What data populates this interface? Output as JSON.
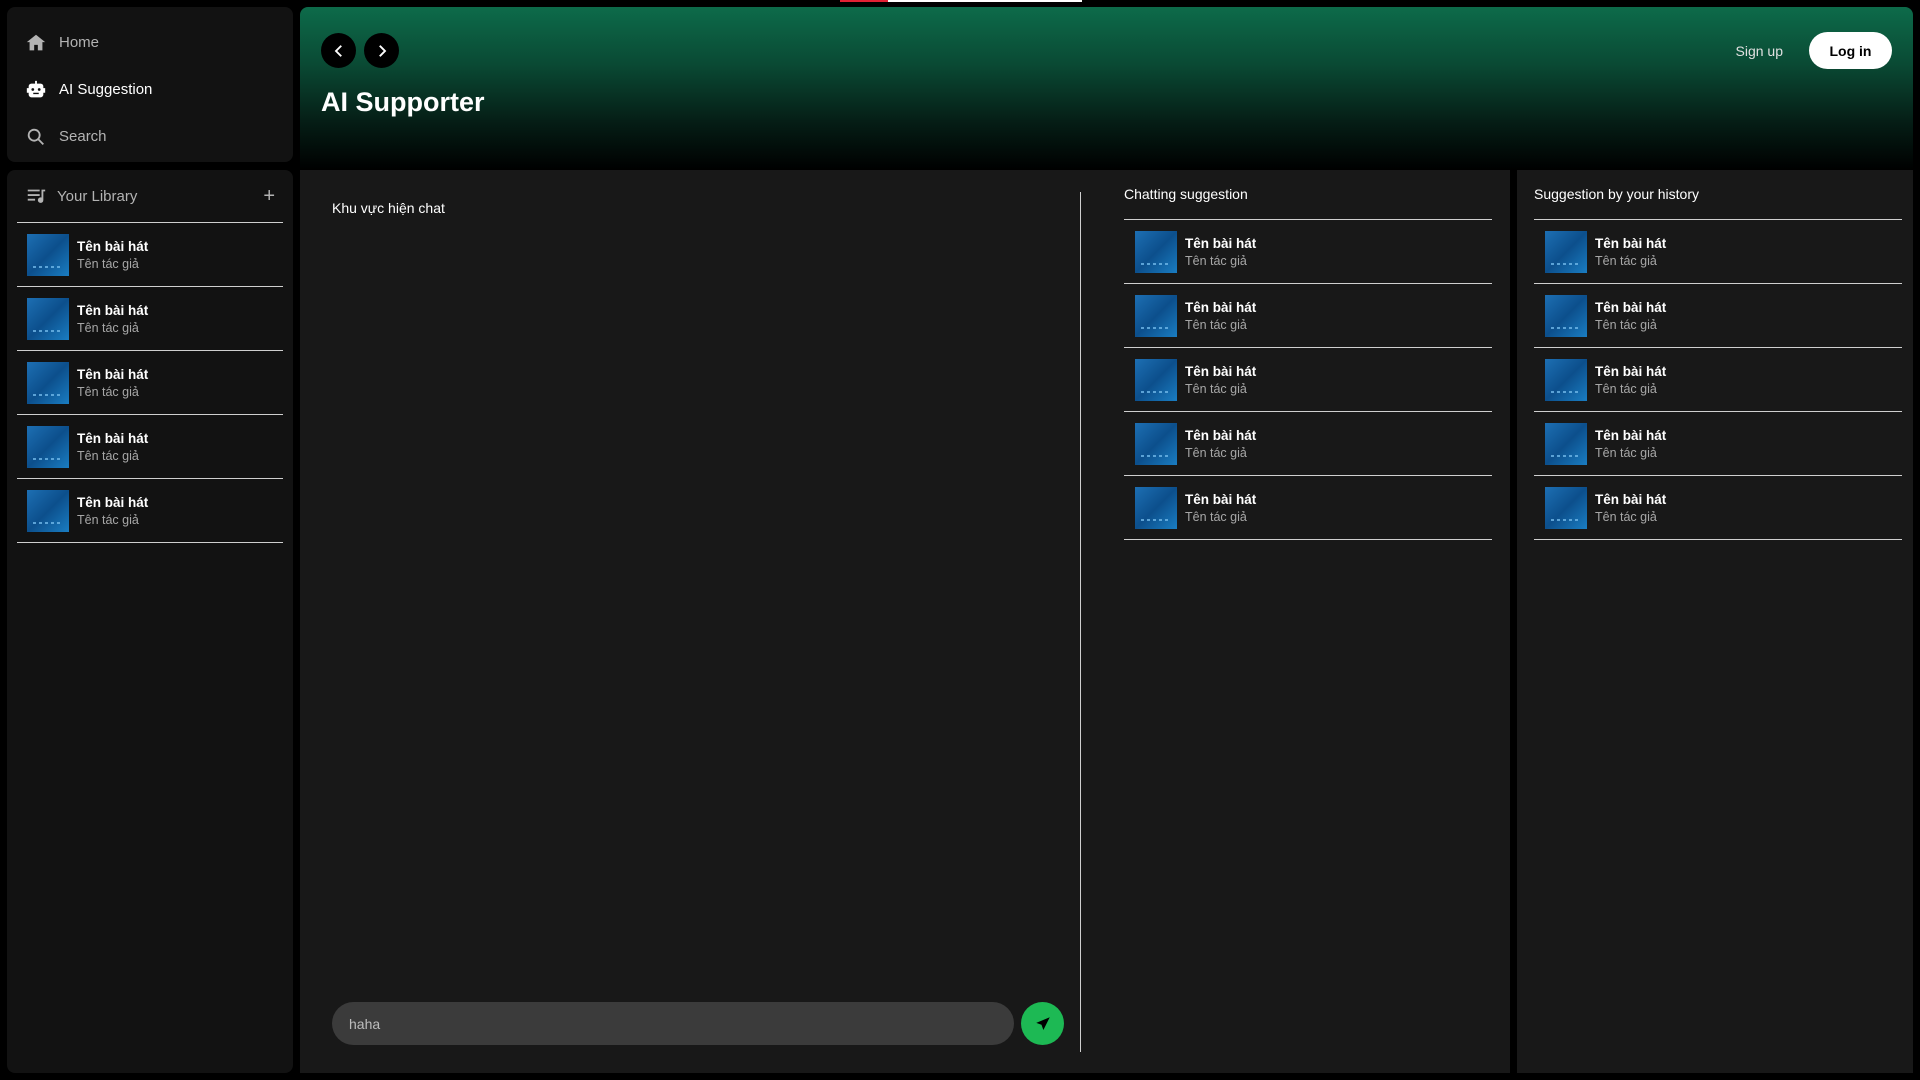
{
  "nav": {
    "items": [
      {
        "label": "Home",
        "icon": "home-icon",
        "active": false
      },
      {
        "label": "AI Suggestion",
        "icon": "robot-icon",
        "active": true
      },
      {
        "label": "Search",
        "icon": "search-icon",
        "active": false
      }
    ]
  },
  "library": {
    "title": "Your Library",
    "add_label": "+",
    "songs": [
      {
        "title": "Tên bài hát",
        "artist": "Tên tác giả"
      },
      {
        "title": "Tên bài hát",
        "artist": "Tên tác giả"
      },
      {
        "title": "Tên bài hát",
        "artist": "Tên tác giả"
      },
      {
        "title": "Tên bài hát",
        "artist": "Tên tác giả"
      },
      {
        "title": "Tên bài hát",
        "artist": "Tên tác giả"
      }
    ]
  },
  "header": {
    "title": "AI Supporter",
    "signup_label": "Sign up",
    "login_label": "Log in"
  },
  "chat": {
    "area_label": "Khu vực hiện chat",
    "input_value": "haha"
  },
  "chatting_suggestion": {
    "title": "Chatting suggestion",
    "songs": [
      {
        "title": "Tên bài hát",
        "artist": "Tên tác giả"
      },
      {
        "title": "Tên bài hát",
        "artist": "Tên tác giả"
      },
      {
        "title": "Tên bài hát",
        "artist": "Tên tác giả"
      },
      {
        "title": "Tên bài hát",
        "artist": "Tên tác giả"
      },
      {
        "title": "Tên bài hát",
        "artist": "Tên tác giả"
      }
    ]
  },
  "history_suggestion": {
    "title": "Suggestion by your history",
    "songs": [
      {
        "title": "Tên bài hát",
        "artist": "Tên tác giả"
      },
      {
        "title": "Tên bài hát",
        "artist": "Tên tác giả"
      },
      {
        "title": "Tên bài hát",
        "artist": "Tên tác giả"
      },
      {
        "title": "Tên bài hát",
        "artist": "Tên tác giả"
      },
      {
        "title": "Tên bài hát",
        "artist": "Tên tác giả"
      }
    ]
  },
  "colors": {
    "accent": "#1db954",
    "header_green": "#0d6b4a",
    "panel": "#181818",
    "sidebar": "#121212"
  }
}
